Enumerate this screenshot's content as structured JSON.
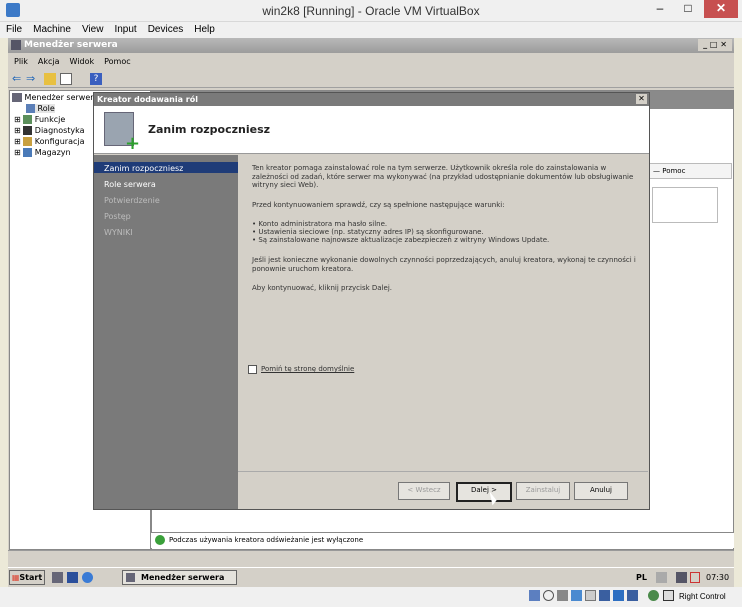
{
  "vbox": {
    "title": "win2k8 [Running] - Oracle VM VirtualBox",
    "menu": [
      "File",
      "Machine",
      "View",
      "Input",
      "Devices",
      "Help"
    ]
  },
  "server_manager": {
    "title": "Menedżer serwera",
    "menu": [
      "Plik",
      "Akcja",
      "Widok",
      "Pomoc"
    ],
    "tree": {
      "root": "Menedżer serwera",
      "items": [
        "Role",
        "Funkcje",
        "Diagnostyka",
        "Konfiguracja",
        "Magazyn"
      ]
    },
    "help_link": "Pomoc",
    "status_text": "Podczas używania kreatora odświeżanie jest wyłączone"
  },
  "wizard": {
    "title": "Kreator dodawania ról",
    "heading": "Zanim rozpoczniesz",
    "nav": [
      "Zanim rozpoczniesz",
      "Role serwera",
      "Potwierdzenie",
      "Postęp",
      "WYNIKI"
    ],
    "body": {
      "p1": "Ten kreator pomaga zainstalować role na tym serwerze. Użytkownik określa role do zainstalowania w zależności od zadań, które serwer ma wykonywać (na przykład udostępnianie dokumentów lub obsługiwanie witryny sieci Web).",
      "p2": "Przed kontynuowaniem sprawdź, czy są spełnione następujące warunki:",
      "bullets": [
        "Konto administratora ma hasło silne.",
        "Ustawienia sieciowe (np. statyczny adres IP) są skonfigurowane.",
        "Są zainstalowane najnowsze aktualizacje zabezpieczeń z witryny Windows Update."
      ],
      "p3": "Jeśli jest konieczne wykonanie dowolnych czynności poprzedzających, anuluj kreatora, wykonaj te czynności i ponownie uruchom kreatora.",
      "p4": "Aby kontynuować, kliknij przycisk Dalej."
    },
    "skip_checkbox": "Pomiń tę stronę domyślnie",
    "buttons": {
      "back": "< Wstecz",
      "next": "Dalej >",
      "install": "Zainstaluj",
      "cancel": "Anuluj"
    }
  },
  "taskbar": {
    "start": "Start",
    "task": "Menedżer serwera",
    "lang": "PL",
    "time": "07:30"
  },
  "host_status": {
    "right_control": "Right Control"
  }
}
